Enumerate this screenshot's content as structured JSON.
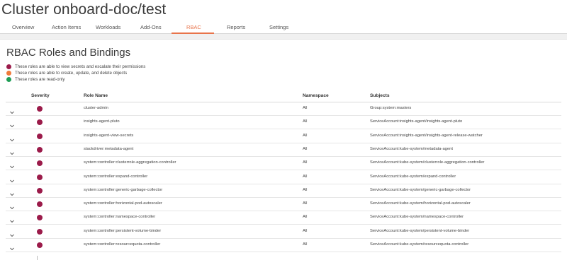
{
  "page": {
    "title": "Cluster onboard-doc/test"
  },
  "tabs": [
    {
      "label": "Overview"
    },
    {
      "label": "Action Items"
    },
    {
      "label": "Workloads"
    },
    {
      "label": "Add-Ons"
    },
    {
      "label": "RBAC",
      "active": true
    },
    {
      "label": "Reports"
    },
    {
      "label": "Settings"
    }
  ],
  "colors": {
    "accent": "#e8744b",
    "severity_high": "#9b1b4a",
    "severity_medium": "#f07a3a",
    "severity_low": "#1f9e56"
  },
  "card": {
    "title": "RBAC Roles and Bindings"
  },
  "legend": [
    {
      "text": "These roles are able to view secrets and escalate their permissions",
      "color": "#9b1b4a"
    },
    {
      "text": "These roles are able to create, update, and delete objects",
      "color": "#f07a3a"
    },
    {
      "text": "These roles are read-only",
      "color": "#1f9e56"
    }
  ],
  "table": {
    "columns": [
      "Severity",
      "Role Name",
      "Namespace",
      "Subjects"
    ],
    "rows": [
      {
        "role": "cluster-admin",
        "namespace": "All",
        "subjects": "Group:system:masters"
      },
      {
        "role": "insights-agent-pluto",
        "namespace": "All",
        "subjects": "ServiceAccount:insights-agent/insights-agent-pluto"
      },
      {
        "role": "insights-agent-view-secrets",
        "namespace": "All",
        "subjects": "ServiceAccount:insights-agent/insights-agent-release-watcher"
      },
      {
        "role": "stackdriver:metadata-agent",
        "namespace": "All",
        "subjects": "ServiceAccount:kube-system/metadata-agent"
      },
      {
        "role": "system:controller:clusterrole-aggregation-controller",
        "namespace": "All",
        "subjects": "ServiceAccount:kube-system/clusterrole-aggregation-controller"
      },
      {
        "role": "system:controller:expand-controller",
        "namespace": "All",
        "subjects": "ServiceAccount:kube-system/expand-controller"
      },
      {
        "role": "system:controller:generic-garbage-collector",
        "namespace": "All",
        "subjects": "ServiceAccount:kube-system/generic-garbage-collector"
      },
      {
        "role": "system:controller:horizontal-pod-autoscaler",
        "namespace": "All",
        "subjects": "ServiceAccount:kube-system/horizontal-pod-autoscaler"
      },
      {
        "role": "system:controller:namespace-controller",
        "namespace": "All",
        "subjects": "ServiceAccount:kube-system/namespace-controller"
      },
      {
        "role": "system:controller:persistent-volume-binder",
        "namespace": "All",
        "subjects": "ServiceAccount:kube-system/persistent-volume-binder"
      },
      {
        "role": "system:controller:resourcequota-controller",
        "namespace": "All",
        "subjects": "ServiceAccount:kube-system/resourcequota-controller"
      }
    ]
  }
}
